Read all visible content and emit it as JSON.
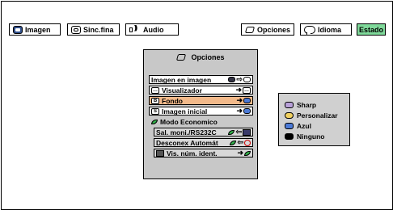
{
  "toolbar": {
    "tabs": [
      {
        "label": "Imagen",
        "icon": "picture-icon"
      },
      {
        "label": "Sinc.fina",
        "icon": "sync-icon"
      },
      {
        "label": "Audio",
        "icon": "speaker-icon"
      }
    ],
    "right_tabs": [
      {
        "label": "Opciones",
        "icon": "options-icon"
      },
      {
        "label": "Idioma",
        "icon": "speech-bubble-icon"
      },
      {
        "label": "Estado"
      }
    ],
    "active_color": "#7fd99a"
  },
  "menu": {
    "title": "Opciones",
    "items": [
      {
        "label": "Imagen en imagen"
      },
      {
        "label": "Visualizador"
      },
      {
        "label": "Fondo",
        "selected": true
      },
      {
        "label": "Imagen inicial"
      },
      {
        "label": "Modo Economico"
      },
      {
        "label": "Sal. moni./RS232C"
      },
      {
        "label": "Desconex Automát"
      },
      {
        "label": "Vis. núm. ident."
      }
    ],
    "selected_color": "#f2b98a"
  },
  "submenu": {
    "options": [
      {
        "label": "Sharp",
        "color": "#b8a0d8"
      },
      {
        "label": "Personalizar",
        "color": "#f0d060"
      },
      {
        "label": "Azul",
        "color": "#4c7ad6"
      },
      {
        "label": "Ninguno",
        "color": "#000000"
      }
    ]
  }
}
